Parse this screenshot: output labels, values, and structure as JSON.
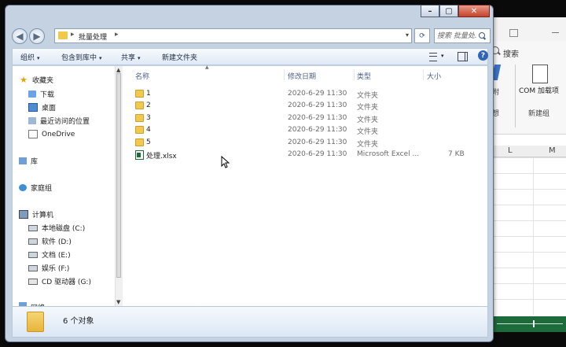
{
  "window": {
    "controls": {
      "minimize": "–",
      "maximize": "▢",
      "close": "✕"
    }
  },
  "address": {
    "crumbs": [
      "批量处理"
    ],
    "separator": "▸",
    "dropdown": "▾",
    "refresh": "⟳",
    "search_placeholder": "搜索 批量处..."
  },
  "toolbar": {
    "organize": "组织",
    "include_in_library": "包含到库中",
    "share": "共享",
    "new_folder": "新建文件夹",
    "caret": "▾",
    "help": "?"
  },
  "nav": {
    "favorites": "收藏夹",
    "downloads": "下载",
    "desktop": "桌面",
    "recent": "最近访问的位置",
    "onedrive": "OneDrive",
    "libraries": "库",
    "homegroup": "家庭组",
    "computer": "计算机",
    "drives": [
      {
        "label": "本地磁盘 (C:)"
      },
      {
        "label": "软件 (D:)"
      },
      {
        "label": "文档 (E:)"
      },
      {
        "label": "娱乐 (F:)"
      },
      {
        "label": "CD 驱动器 (G:)"
      }
    ],
    "network": "网络"
  },
  "columns": {
    "name": "名称",
    "modified": "修改日期",
    "type": "类型",
    "size": "大小"
  },
  "files": [
    {
      "name": "1",
      "date": "2020-6-29 11:30",
      "type": "文件夹",
      "size": "",
      "kind": "folder"
    },
    {
      "name": "2",
      "date": "2020-6-29 11:30",
      "type": "文件夹",
      "size": "",
      "kind": "folder"
    },
    {
      "name": "3",
      "date": "2020-6-29 11:30",
      "type": "文件夹",
      "size": "",
      "kind": "folder"
    },
    {
      "name": "4",
      "date": "2020-6-29 11:30",
      "type": "文件夹",
      "size": "",
      "kind": "folder"
    },
    {
      "name": "5",
      "date": "2020-6-29 11:30",
      "type": "文件夹",
      "size": "",
      "kind": "folder"
    },
    {
      "name": "处理.xlsx",
      "date": "2020-6-29 11:30",
      "type": "Microsoft Excel ...",
      "size": "7 KB",
      "kind": "xlsx"
    }
  ],
  "status": {
    "count": "6 个对象"
  },
  "excel": {
    "search": "搜索",
    "com_addin": "COM 加载项",
    "group_new": "新建组",
    "cut_a": "附",
    "cut_b": "想",
    "col_l": "L",
    "col_m": "M"
  },
  "colors": {
    "folder": "#f2c94c",
    "excel_green": "#1d6b3a",
    "close_red": "#c5432a",
    "chrome_blue": "#c4d2e2"
  }
}
